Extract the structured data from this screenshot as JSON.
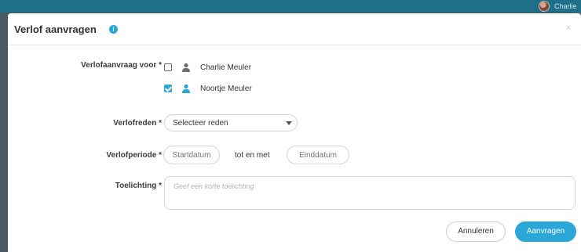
{
  "app": {
    "user_name": "Charlie"
  },
  "modal": {
    "title": "Verlof aanvragen",
    "info_icon": "info-icon",
    "close_icon": "close-icon",
    "close_glyph": "×"
  },
  "form": {
    "request_for": {
      "label": "Verlofaanvraag voor *",
      "options": [
        {
          "name": "Charlie Meuler",
          "checked": false,
          "icon": "person-icon",
          "icon_color": "#6e6e6e"
        },
        {
          "name": "Noortje Meuler",
          "checked": true,
          "icon": "person-icon",
          "icon_color": "#2aa7d8"
        }
      ]
    },
    "reason": {
      "label": "Verlofreden *",
      "value": "Selecteer reden",
      "icon": "caret-down-icon"
    },
    "period": {
      "label": "Verlofperiode *",
      "start_placeholder": "Startdatum",
      "middle_text": "tot en met",
      "end_placeholder": "Einddatum"
    },
    "explanation": {
      "label": "Toelichting *",
      "placeholder": "Geef een korte toelichting"
    }
  },
  "buttons": {
    "cancel": "Annuleren",
    "submit": "Aanvragen"
  },
  "colors": {
    "accent": "#2aa7d8",
    "topbar": "#1f6f8b",
    "backdrop": "#4a5a63"
  }
}
